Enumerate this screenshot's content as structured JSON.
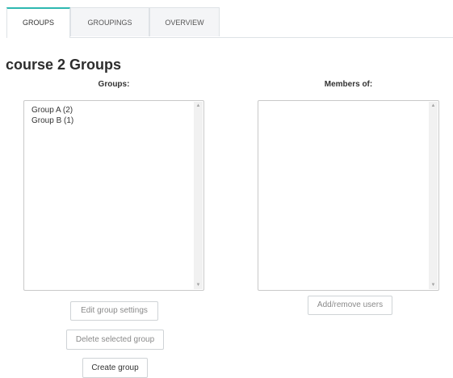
{
  "tabs": [
    {
      "label": "GROUPS",
      "active": true
    },
    {
      "label": "GROUPINGS",
      "active": false
    },
    {
      "label": "OVERVIEW",
      "active": false
    }
  ],
  "page": {
    "title": "course 2 Groups"
  },
  "groups_panel": {
    "header": "Groups:",
    "items": [
      "Group A (2)",
      "Group B (1)"
    ],
    "buttons": {
      "edit": "Edit group settings",
      "delete": "Delete selected group",
      "create": "Create group"
    }
  },
  "members_panel": {
    "header": "Members of:",
    "items": [],
    "buttons": {
      "add_remove": "Add/remove users"
    }
  },
  "icons": {
    "scroll_up": "▲",
    "scroll_down": "▼"
  },
  "colors": {
    "active_tab_accent": "#2eb8b0",
    "inactive_tab_bg": "#f4f5f7",
    "border": "#c9c9c9"
  }
}
